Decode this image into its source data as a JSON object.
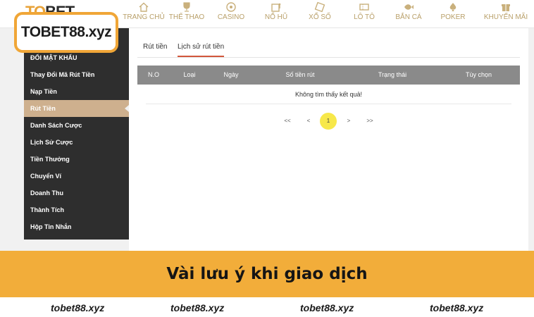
{
  "brand": {
    "header_text_a": "TO",
    "header_text_b": "BET",
    "logo": "TOBET88.xyz"
  },
  "nav": [
    {
      "label": "TRANG CHỦ",
      "icon": "home-icon"
    },
    {
      "label": "THỂ THAO",
      "icon": "trophy-icon"
    },
    {
      "label": "CASINO",
      "icon": "casino-icon"
    },
    {
      "label": "NỔ HŨ",
      "icon": "slot-icon"
    },
    {
      "label": "XỔ SỐ",
      "icon": "lottery-icon"
    },
    {
      "label": "LÔ TÔ",
      "icon": "ticket-icon"
    },
    {
      "label": "BẮN CÁ",
      "icon": "fish-icon"
    },
    {
      "label": "POKER",
      "icon": "spade-icon"
    },
    {
      "label": "KHUYẾN MÃI",
      "icon": "gift-icon"
    }
  ],
  "sidebar": {
    "items": [
      {
        "label": "ĐỔI MẬT KHẨU"
      },
      {
        "label": "Thay Đổi Mã Rút Tiền"
      },
      {
        "label": "Nạp Tiền"
      },
      {
        "label": "Rút Tiền",
        "active": true
      },
      {
        "label": "Danh Sách Cược"
      },
      {
        "label": "Lịch Sử Cược"
      },
      {
        "label": "Tiền Thưởng"
      },
      {
        "label": "Chuyển Ví"
      },
      {
        "label": "Doanh Thu"
      },
      {
        "label": "Thành Tích"
      },
      {
        "label": "Hộp Tin Nhắn"
      }
    ]
  },
  "tabs": [
    {
      "label": "Rút tiền",
      "active": false
    },
    {
      "label": "Lịch sử rút tiền",
      "active": true
    }
  ],
  "table": {
    "columns": [
      "N.O",
      "Loại",
      "Ngày",
      "Số tiền rút",
      "Trạng thái",
      "Tùy chọn"
    ],
    "empty_message": "Không tìm thấy kết quả!"
  },
  "pagination": {
    "first": "<<",
    "prev": "<",
    "current": "1",
    "next": ">",
    "last": ">>"
  },
  "caption": "Vài lưu ý khi giao dịch",
  "footer": [
    "tobet88.xyz",
    "tobet88.xyz",
    "tobet88.xyz",
    "tobet88.xyz"
  ],
  "colors": {
    "accent": "#f2ad3a",
    "sidebar_bg": "#2e2e2e",
    "sidebar_active": "#ceb08e",
    "table_header": "#8a8a8a",
    "tab_underline": "#d2573c",
    "page_current": "#f7e84a"
  }
}
